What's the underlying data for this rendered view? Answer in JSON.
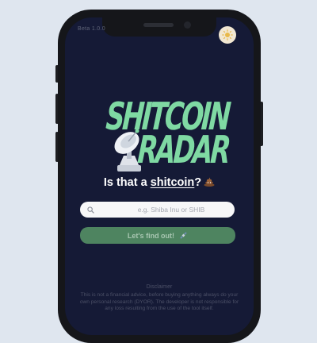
{
  "app": {
    "version": "Beta 1.0.0",
    "theme_toggle_icon": "sun-icon"
  },
  "logo": {
    "line1": "SHITCOIN",
    "line2": "RADAR",
    "color": "#7fd9a3",
    "icon": "satellite-dish-icon"
  },
  "headline": {
    "prefix": "Is that a ",
    "link": "shitcoin",
    "suffix": "?",
    "emoji_icon": "poop-icon"
  },
  "search": {
    "placeholder": "e.g. Shiba Inu or SHIB",
    "value": "",
    "icon": "search-icon"
  },
  "cta": {
    "label": "Let's find out!",
    "icon": "satellite-icon",
    "color": "#4e8460"
  },
  "disclaimer": {
    "title": "Disclaimer",
    "text": "This is not a financial advice, before buying anything always do your own personal research (DYOR). The developer is not responsible for any loss resulting from the use of the tool itself."
  },
  "colors": {
    "background": "#dfe6ef",
    "screen": "#151a36"
  }
}
